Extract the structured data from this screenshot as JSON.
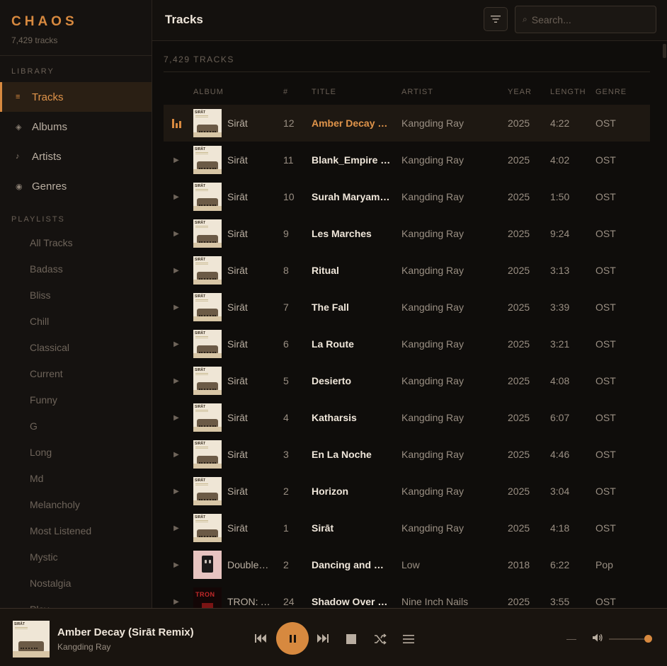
{
  "brand": {
    "title": "CHAOS",
    "subtitle": "7,429 tracks"
  },
  "sidebar": {
    "library_label": "LIBRARY",
    "nav": [
      {
        "label": "Tracks",
        "icon": "list-icon",
        "glyph": "≡",
        "active": true
      },
      {
        "label": "Albums",
        "icon": "album-icon",
        "glyph": "◈",
        "active": false
      },
      {
        "label": "Artists",
        "icon": "note-icon",
        "glyph": "♪",
        "active": false
      },
      {
        "label": "Genres",
        "icon": "genre-icon",
        "glyph": "◉",
        "active": false
      }
    ],
    "playlists_label": "PLAYLISTS",
    "playlists": [
      "All Tracks",
      "Badass",
      "Bliss",
      "Chill",
      "Classical",
      "Current",
      "Funny",
      "G",
      "Long",
      "Md",
      "Melancholy",
      "Most Listened",
      "Mystic",
      "Nostalgia",
      "Play"
    ]
  },
  "header": {
    "title": "Tracks",
    "search_placeholder": "Search..."
  },
  "main": {
    "count_label": "7,429 TRACKS",
    "columns": {
      "album": "ALBUM",
      "num": "#",
      "title": "TITLE",
      "artist": "ARTIST",
      "year": "YEAR",
      "length": "LENGTH",
      "genre": "GENRE"
    },
    "tracks": [
      {
        "album": "Sirāt",
        "num": "12",
        "title": "Amber Decay (Sirāt Remix)",
        "artist": "Kangding Ray",
        "year": "2025",
        "length": "4:22",
        "genre": "OST",
        "art": "sirat",
        "playing": true
      },
      {
        "album": "Sirāt",
        "num": "11",
        "title": "Blank_Empire (Sirāt Edit)",
        "artist": "Kangding Ray",
        "year": "2025",
        "length": "4:02",
        "genre": "OST",
        "art": "sirat"
      },
      {
        "album": "Sirāt",
        "num": "10",
        "title": "Surah Maryam (Sirāt)",
        "artist": "Kangding Ray",
        "year": "2025",
        "length": "1:50",
        "genre": "OST",
        "art": "sirat"
      },
      {
        "album": "Sirāt",
        "num": "9",
        "title": "Les Marches",
        "artist": "Kangding Ray",
        "year": "2025",
        "length": "9:24",
        "genre": "OST",
        "art": "sirat"
      },
      {
        "album": "Sirāt",
        "num": "8",
        "title": "Ritual",
        "artist": "Kangding Ray",
        "year": "2025",
        "length": "3:13",
        "genre": "OST",
        "art": "sirat"
      },
      {
        "album": "Sirāt",
        "num": "7",
        "title": "The Fall",
        "artist": "Kangding Ray",
        "year": "2025",
        "length": "3:39",
        "genre": "OST",
        "art": "sirat"
      },
      {
        "album": "Sirāt",
        "num": "6",
        "title": "La Route",
        "artist": "Kangding Ray",
        "year": "2025",
        "length": "3:21",
        "genre": "OST",
        "art": "sirat"
      },
      {
        "album": "Sirāt",
        "num": "5",
        "title": "Desierto",
        "artist": "Kangding Ray",
        "year": "2025",
        "length": "4:08",
        "genre": "OST",
        "art": "sirat"
      },
      {
        "album": "Sirāt",
        "num": "4",
        "title": "Katharsis",
        "artist": "Kangding Ray",
        "year": "2025",
        "length": "6:07",
        "genre": "OST",
        "art": "sirat"
      },
      {
        "album": "Sirāt",
        "num": "3",
        "title": "En La Noche",
        "artist": "Kangding Ray",
        "year": "2025",
        "length": "4:46",
        "genre": "OST",
        "art": "sirat"
      },
      {
        "album": "Sirāt",
        "num": "2",
        "title": "Horizon",
        "artist": "Kangding Ray",
        "year": "2025",
        "length": "3:04",
        "genre": "OST",
        "art": "sirat"
      },
      {
        "album": "Sirāt",
        "num": "1",
        "title": "Sirāt",
        "artist": "Kangding Ray",
        "year": "2025",
        "length": "4:18",
        "genre": "OST",
        "art": "sirat"
      },
      {
        "album": "Double Negative",
        "num": "2",
        "title": "Dancing and Blood",
        "artist": "Low",
        "year": "2018",
        "length": "6:22",
        "genre": "Pop",
        "art": "low"
      },
      {
        "album": "TRON: Ares",
        "num": "24",
        "title": "Shadow Over Me",
        "artist": "Nine Inch Nails",
        "year": "2025",
        "length": "3:55",
        "genre": "OST",
        "art": "tron"
      }
    ]
  },
  "player": {
    "title": "Amber Decay (Sirāt Remix)",
    "artist": "Kangding Ray",
    "volume": 0.92,
    "icons": {
      "prev": "previous-icon",
      "play": "pause-icon",
      "next": "next-icon",
      "stop": "stop-icon",
      "shuffle": "shuffle-icon",
      "queue": "queue-icon",
      "volume": "volume-icon"
    }
  },
  "colors": {
    "accent": "#d7893f",
    "background": "#0f0d0b",
    "sidebar": "#151210",
    "active_row": "#1e1812"
  }
}
